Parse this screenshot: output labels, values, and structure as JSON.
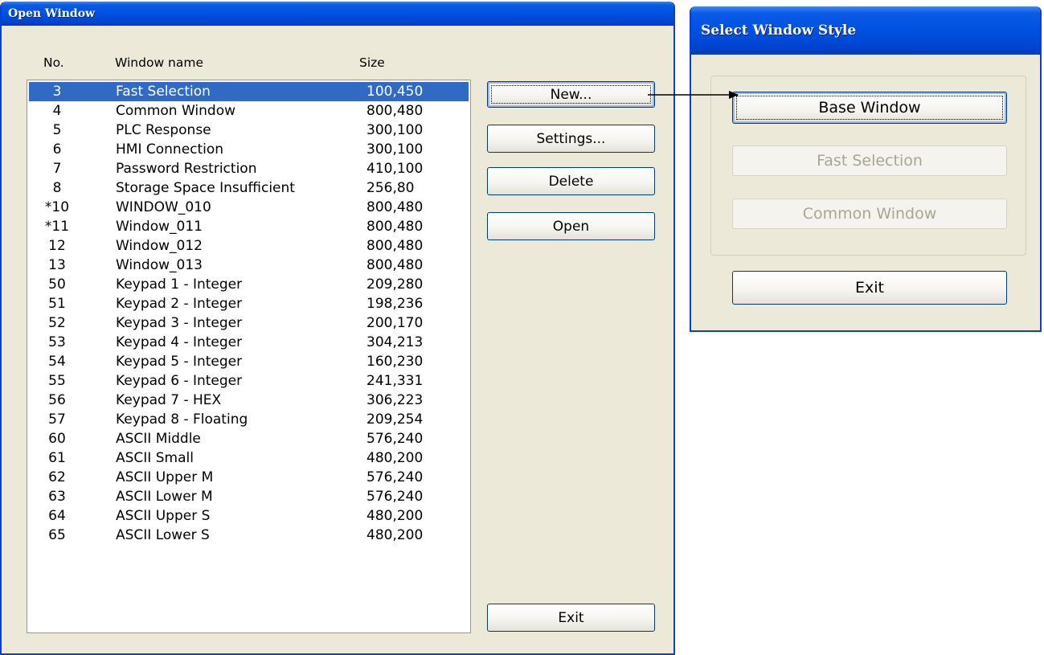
{
  "open_window": {
    "title": "Open Window",
    "columns": {
      "no": "No.",
      "name": "Window name",
      "size": "Size"
    },
    "rows": [
      {
        "no": "3",
        "name": "Fast Selection",
        "size": "100,450",
        "selected": true
      },
      {
        "no": "4",
        "name": "Common Window",
        "size": "800,480"
      },
      {
        "no": "5",
        "name": "PLC Response",
        "size": "300,100"
      },
      {
        "no": "6",
        "name": "HMI Connection",
        "size": "300,100"
      },
      {
        "no": "7",
        "name": "Password Restriction",
        "size": "410,100"
      },
      {
        "no": "8",
        "name": "Storage Space Insufficient",
        "size": "256,80"
      },
      {
        "no": "*10",
        "name": "WINDOW_010",
        "size": "800,480"
      },
      {
        "no": "*11",
        "name": "Window_011",
        "size": "800,480"
      },
      {
        "no": "12",
        "name": "Window_012",
        "size": "800,480"
      },
      {
        "no": "13",
        "name": "Window_013",
        "size": "800,480"
      },
      {
        "no": "50",
        "name": "Keypad 1 - Integer",
        "size": "209,280"
      },
      {
        "no": "51",
        "name": "Keypad 2 - Integer",
        "size": "198,236"
      },
      {
        "no": "52",
        "name": "Keypad 3 - Integer",
        "size": "200,170"
      },
      {
        "no": "53",
        "name": "Keypad 4 - Integer",
        "size": "304,213"
      },
      {
        "no": "54",
        "name": "Keypad 5 - Integer",
        "size": "160,230"
      },
      {
        "no": "55",
        "name": "Keypad 6 - Integer",
        "size": "241,331"
      },
      {
        "no": "56",
        "name": "Keypad 7 - HEX",
        "size": "306,223"
      },
      {
        "no": "57",
        "name": "Keypad 8 - Floating",
        "size": "209,254"
      },
      {
        "no": "60",
        "name": "ASCII Middle",
        "size": "576,240"
      },
      {
        "no": "61",
        "name": "ASCII Small",
        "size": "480,200"
      },
      {
        "no": "62",
        "name": "ASCII Upper M",
        "size": "576,240"
      },
      {
        "no": "63",
        "name": "ASCII Lower M",
        "size": "576,240"
      },
      {
        "no": "64",
        "name": "ASCII Upper S",
        "size": "480,200"
      },
      {
        "no": "65",
        "name": "ASCII Lower S",
        "size": "480,200"
      }
    ],
    "buttons": {
      "new": "New...",
      "settings": "Settings...",
      "delete": "Delete",
      "open": "Open",
      "exit": "Exit"
    }
  },
  "style_window": {
    "title": "Select Window Style",
    "buttons": {
      "base": "Base Window",
      "fast": "Fast Selection",
      "common": "Common Window",
      "exit": "Exit"
    },
    "disabled": [
      "fast",
      "common"
    ]
  },
  "colors": {
    "titlebar": "#0054e3",
    "selection": "#316ac5",
    "dialog_bg": "#ece9d8"
  }
}
